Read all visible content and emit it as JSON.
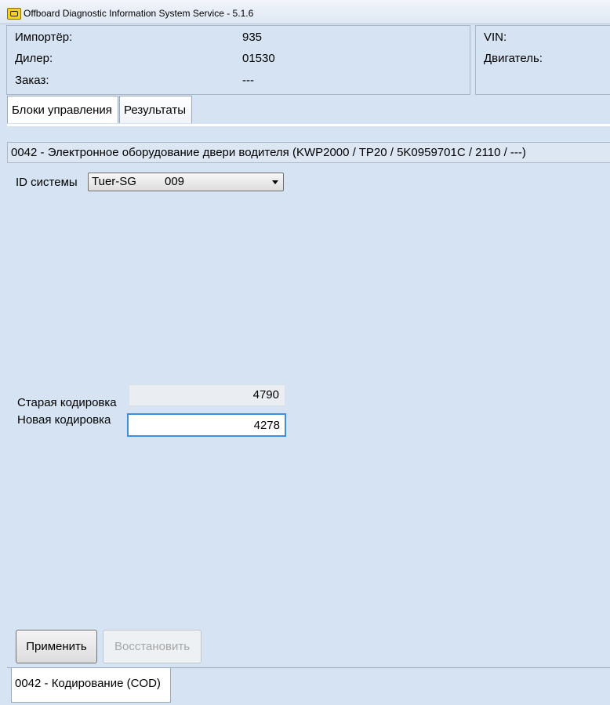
{
  "window": {
    "title": "Offboard Diagnostic Information System Service - 5.1.6"
  },
  "info": {
    "importer_label": "Импортёр:",
    "importer_value": "935",
    "dealer_label": "Дилер:",
    "dealer_value": "01530",
    "order_label": "Заказ:",
    "order_value": "---",
    "vin_label": "VIN:",
    "engine_label": "Двигатель:"
  },
  "tabs": [
    {
      "label": "Блоки управления"
    },
    {
      "label": "Результаты"
    }
  ],
  "module": {
    "header": "0042 - Электронное оборудование двери водителя  (KWP2000 / TP20 / 5K0959701C / 2110 / ---)"
  },
  "system_id": {
    "label": "ID системы",
    "selected_name": "Tuer-SG",
    "selected_number": "009"
  },
  "coding": {
    "old_label": "Старая кодировка",
    "old_value": "4790",
    "new_label": "Новая кодировка",
    "new_value": "4278"
  },
  "buttons": {
    "apply": "Применить",
    "restore": "Восстановить"
  },
  "bottom_tab": {
    "label": "0042 - Кодирование (COD)"
  },
  "colors": {
    "background": "#d6e3f2",
    "focus_border": "#3d8ee0",
    "disabled_text": "#a6a6a6"
  }
}
